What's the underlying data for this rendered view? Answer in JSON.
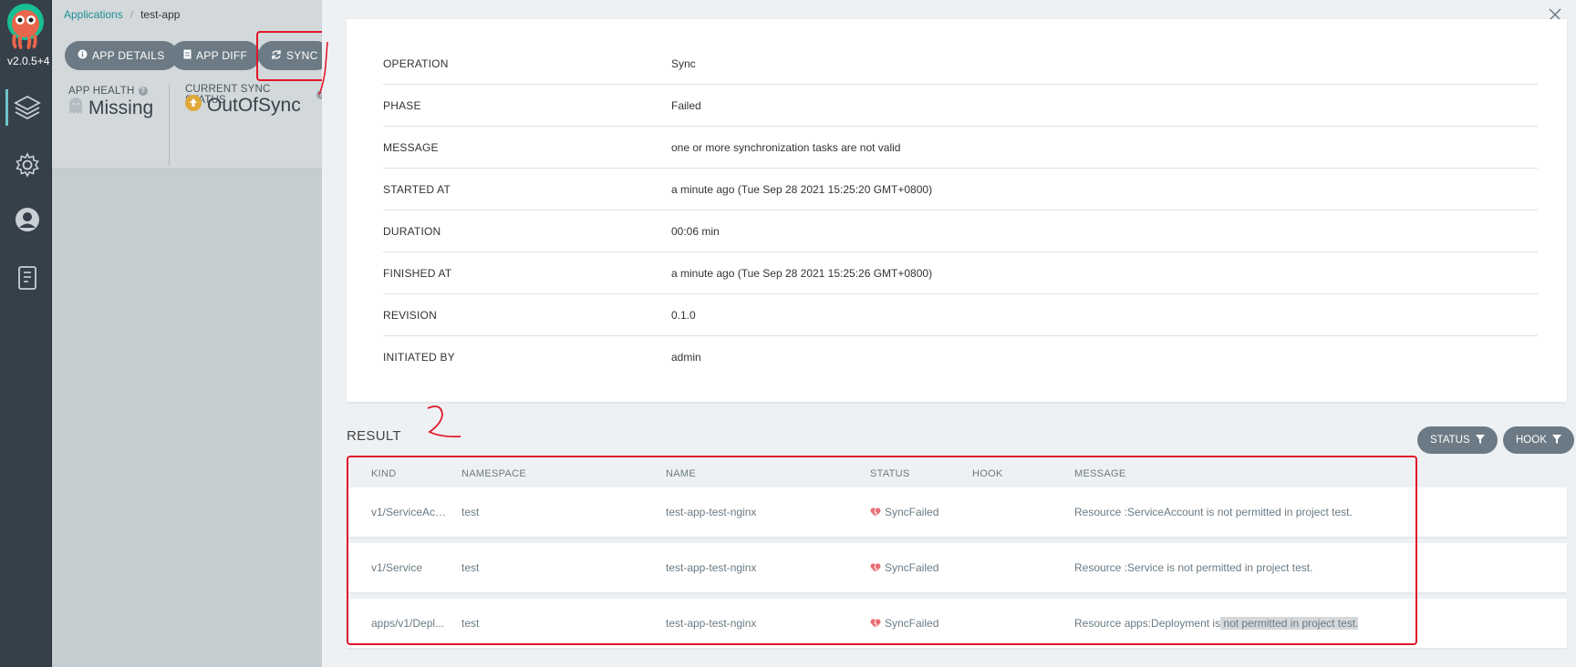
{
  "nav": {
    "version": "v2.0.5+4",
    "items": [
      {
        "icon": "layers-icon"
      },
      {
        "icon": "gear-icon"
      },
      {
        "icon": "user-icon"
      },
      {
        "icon": "docs-icon"
      }
    ]
  },
  "app": {
    "breadcrumb": {
      "root": "Applications",
      "current": "test-app"
    },
    "toolbar": {
      "details": "APP DETAILS",
      "diff": "APP DIFF",
      "sync": "SYNC"
    },
    "health": {
      "label": "APP HEALTH",
      "value": "Missing"
    },
    "sync_status": {
      "label": "CURRENT SYNC STATUS",
      "value": "OutOfSync"
    }
  },
  "operation": [
    {
      "key": "OPERATION",
      "value": "Sync"
    },
    {
      "key": "PHASE",
      "value": "Failed"
    },
    {
      "key": "MESSAGE",
      "value": "one or more synchronization tasks are not valid"
    },
    {
      "key": "STARTED AT",
      "value": "a minute ago (Tue Sep 28 2021 15:25:20 GMT+0800)"
    },
    {
      "key": "DURATION",
      "value": "00:06 min"
    },
    {
      "key": "FINISHED AT",
      "value": "a minute ago (Tue Sep 28 2021 15:25:26 GMT+0800)"
    },
    {
      "key": "REVISION",
      "value": "0.1.0"
    },
    {
      "key": "INITIATED BY",
      "value": "admin"
    }
  ],
  "result": {
    "title": "RESULT",
    "filters": {
      "status": "STATUS",
      "hook": "HOOK"
    },
    "columns": {
      "kind": "KIND",
      "namespace": "NAMESPACE",
      "name": "NAME",
      "status": "STATUS",
      "hook": "HOOK",
      "message": "MESSAGE"
    },
    "rows": [
      {
        "kind": "v1/ServiceAcc...",
        "namespace": "test",
        "name": "test-app-test-nginx",
        "status": "SyncFailed",
        "hook": "",
        "message": "Resource :ServiceAccount is not permitted in project test.",
        "message_a": "",
        "message_b": ""
      },
      {
        "kind": "v1/Service",
        "namespace": "test",
        "name": "test-app-test-nginx",
        "status": "SyncFailed",
        "hook": "",
        "message": "Resource :Service is not permitted in project test.",
        "message_a": "",
        "message_b": ""
      },
      {
        "kind": "apps/v1/Depl...",
        "namespace": "test",
        "name": "test-app-test-nginx",
        "status": "SyncFailed",
        "hook": "",
        "message": "",
        "message_a": "Resource apps:Deployment is",
        "message_b": " not permitted in project test."
      }
    ]
  },
  "colors": {
    "accent": "#1e8f94",
    "button": "#6b7a84",
    "annotation": "#e0182b",
    "error_heart": "#e96d76"
  }
}
